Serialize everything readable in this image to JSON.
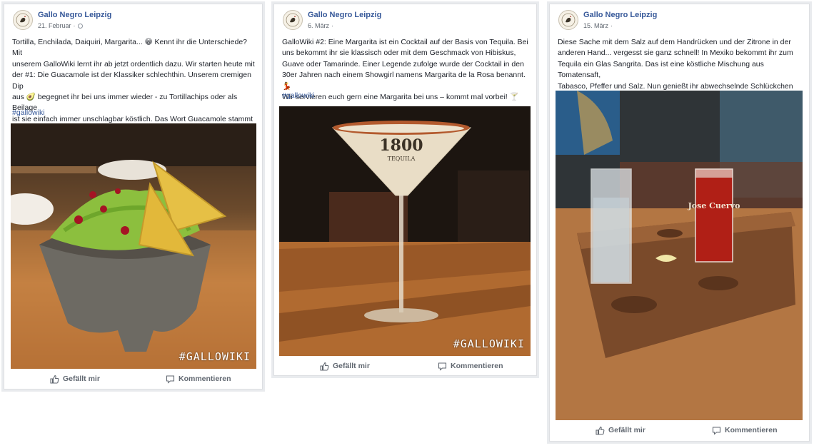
{
  "colors": {
    "link": "#365899",
    "text": "#1d2129",
    "meta": "#606770",
    "border": "#dddfe2"
  },
  "posts": [
    {
      "page_name": "Gallo Negro Leipzig",
      "date": "21. Februar",
      "body": "Tortilla, Enchilada, Daiquiri, Margarita... 😁 Kennt ihr die Unterschiede? Mit\nunserem GalloWiki lernt ihr ab jetzt ordentlich dazu. Wir starten heute mit\nder #1: Die Guacamole ist der Klassiker schlechthin. Unserem cremigen Dip\naus 🥑 begegnet ihr bei uns immer wieder - zu Tortillachips oder als Beilage\nist sie einfach immer unschlagbar köstlich. Das Wort Guacamole stammt\nübrigens vom aztekischen Wort ahuacamolli ab und bedeutet wörtlich\nübersetzt Avocadogebräu. 😉",
      "hashtag": "#gallowiki",
      "photo_overlay": "#GALLOWIKI",
      "like_label": "Gefällt mir",
      "comment_label": "Kommentieren"
    },
    {
      "page_name": "Gallo Negro Leipzig",
      "date": "6. März",
      "body": "GalloWiki #2: Eine Margarita ist ein Cocktail auf der Basis von Tequila. Bei\nuns bekommt ihr sie klassisch oder mit dem Geschmack von Hibiskus,\nGuave oder Tamarinde. Einer Legende zufolge wurde der Cocktail in den\n30er Jahren nach einem Showgirl namens Margarita de la Rosa benannt. 💃\n Wir servieren euch gern eine Margarita bei uns – kommt mal vorbei! 🍸",
      "hashtag": "#gallowiki",
      "photo_overlay": "#GALLOWIKI",
      "glass_brand": "1800",
      "glass_sub": "TEQUILA",
      "like_label": "Gefällt mir",
      "comment_label": "Kommentieren"
    },
    {
      "page_name": "Gallo Negro Leipzig",
      "date": "15. März",
      "body": "Diese Sache mit dem Salz auf dem Handrücken und der Zitrone in der\nanderen Hand... vergesst sie ganz schnell! In Mexiko bekommt ihr zum\nTequila ein Glas Sangrita. Das ist eine köstliche Mischung aus Tomatensaft,\nTabasco, Pfeffer und Salz. Nun genießt ihr abwechselnde Schlückchen aus\nbeiden Gläsern. So geht das! 😉",
      "glass_brand": "Jose Cuervo",
      "like_label": "Gefällt mir",
      "comment_label": "Kommentieren"
    }
  ]
}
